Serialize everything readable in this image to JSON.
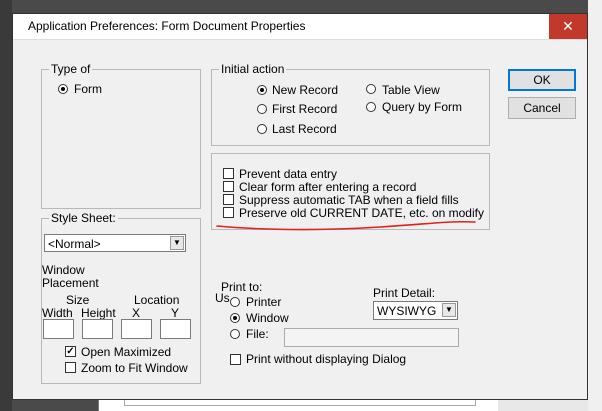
{
  "dialog": {
    "title": "Application Preferences:  Form Document Properties",
    "close_icon": "close-icon"
  },
  "type_of": {
    "legend": "Type of",
    "option": "Form"
  },
  "initial_action": {
    "legend": "Initial action",
    "options": [
      "New Record",
      "Table View",
      "First Record",
      "Query by Form",
      "Last Record"
    ],
    "selected": "New Record"
  },
  "options": {
    "prevent": "Prevent data entry",
    "clear": "Clear form after entering a record",
    "suppress": "Suppress automatic TAB when a field fills",
    "preserve": "Preserve old CURRENT DATE, etc. on modify"
  },
  "buttons": {
    "ok": "OK",
    "cancel": "Cancel"
  },
  "style_sheet": {
    "legend": "Style Sheet:",
    "value": "<Normal>",
    "window_placement_line1": "Window",
    "window_placement_line2": "Placement",
    "size": "Size",
    "location": "Location",
    "width": "Width",
    "height": "Height",
    "x": "X",
    "y": "Y",
    "open_maximized": "Open Maximized",
    "open_maximized_checked": true,
    "zoom_to_fit": "Zoom to Fit Window",
    "zoom_to_fit_checked": false
  },
  "print": {
    "print_to": "Print to:",
    "partial_label": "Us",
    "printer": "Printer",
    "window": "Window",
    "file": "File:",
    "selected": "Window",
    "print_detail_label": "Print Detail:",
    "print_detail_value": "WYSIWYG",
    "without_dialog": "Print without displaying Dialog"
  },
  "annotation_color": "#e0201a"
}
